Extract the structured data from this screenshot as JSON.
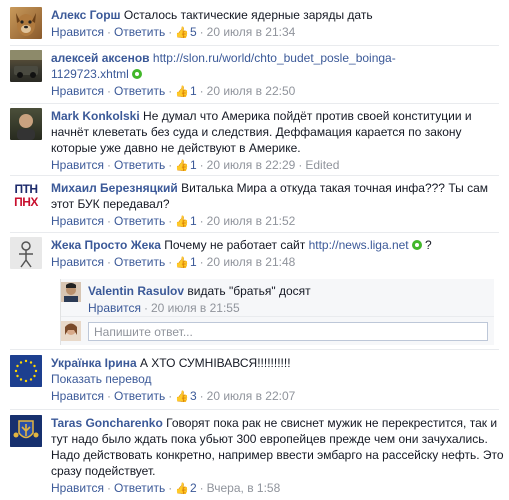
{
  "comments": [
    {
      "author": "Алекс Горш",
      "text": "Осталось тактические ядерные заряды дать",
      "meta": {
        "like": "Нравится",
        "reply": "Ответить",
        "likes": "5",
        "time": "20 июля в 21:34"
      }
    },
    {
      "author": "алексей аксенов",
      "link_line1": "http://slon.ru/world/chto_budet_posle_boinga-",
      "link_line2": "1129723.xhtml",
      "meta": {
        "like": "Нравится",
        "reply": "Ответить",
        "likes": "1",
        "time": "20 июля в 22:50"
      }
    },
    {
      "author": "Mark Konkolski",
      "text": "Не думал что Америка пойдёт против своей конституции и начнёт клеветать без суда и следствия. Деффамация карается по закону которые уже давно не действуют в Америке.",
      "meta": {
        "like": "Нравится",
        "reply": "Ответить",
        "likes": "1",
        "time": "20 июля в 22:29",
        "edited": "Edited"
      }
    },
    {
      "author": "Михаил Березняцкий",
      "text": "Виталька Мира а откуда такая точная инфа??? Ты сам этот БУК передавал?",
      "meta": {
        "like": "Нравится",
        "reply": "Ответить",
        "likes": "1",
        "time": "20 июля в 21:52"
      }
    },
    {
      "author": "Жека Просто Жека",
      "text": "Почему не работает сайт",
      "link": "http://news.liga.net",
      "trailing": "?",
      "meta": {
        "like": "Нравится",
        "reply": "Ответить",
        "likes": "1",
        "time": "20 июля в 21:48"
      },
      "reply": {
        "author": "Valentin Rasulov",
        "text": "видать \"братья\" досят",
        "meta": {
          "like": "Нравится",
          "time": "20 июля в 21:55"
        }
      },
      "reply_placeholder": "Напишите ответ..."
    },
    {
      "author": "Українка Ірина",
      "text": "А ХТО СУМНІВАВСЯ!!!!!!!!!!",
      "translate": "Показать перевод",
      "meta": {
        "like": "Нравится",
        "reply": "Ответить",
        "likes": "3",
        "time": "20 июля в 22:07"
      }
    },
    {
      "author": "Taras Goncharenko",
      "text": "Говорят пока рак не свиснет мужик не перекрестится, так и тут надо было ждать пока убьют 300 европейцев прежде чем они зачухались. Надо действовать конкретно, например ввести эмбарго на рассейску нефть. Это сразу подействует.",
      "meta": {
        "like": "Нравится",
        "reply": "Ответить",
        "likes": "2",
        "time": "Вчера, в 1:58"
      }
    }
  ],
  "avatar4_text": [
    "ПТН",
    "ПНХ"
  ],
  "colors": {
    "link": "#3b5998",
    "meta": "#90949c",
    "text": "#141823",
    "green": "#42b72a"
  }
}
